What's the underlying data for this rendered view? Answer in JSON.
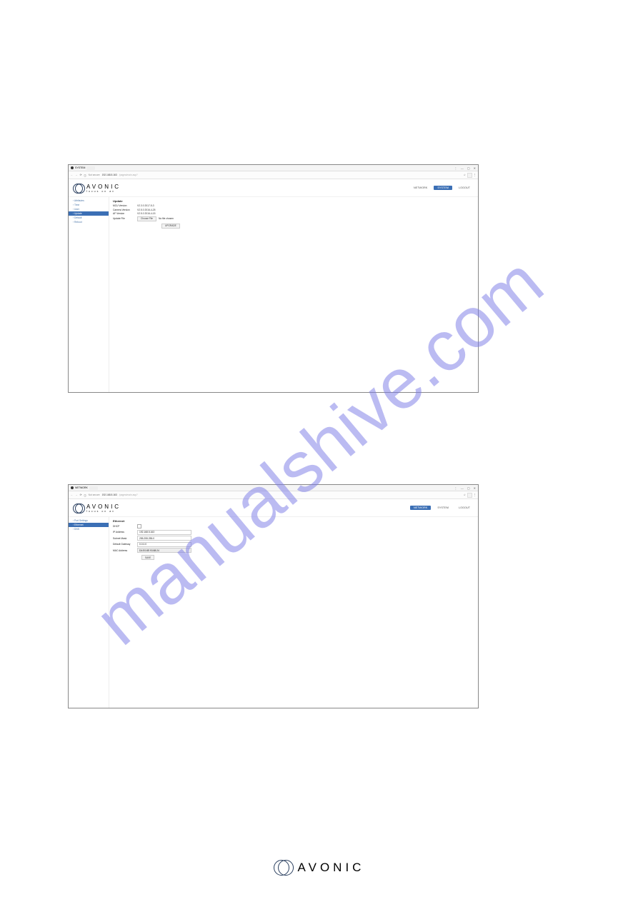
{
  "watermark": "manualshive.com",
  "footer_brand": "AVONIC",
  "screenshot1": {
    "tab_title": "SYSTEM",
    "not_secure": "Not secure",
    "url_host": "192.168.5.163",
    "url_path": "/pages/main.asp?",
    "logo_main": "AVONIC",
    "logo_sub": "focus on av",
    "header_tabs": {
      "network": "NETWORK",
      "system": "SYSTEM",
      "logout": "LOGOUT"
    },
    "sidebar": {
      "items": [
        {
          "label": "Attributes"
        },
        {
          "label": "Time"
        },
        {
          "label": "User"
        },
        {
          "label": "Update"
        },
        {
          "label": "Default"
        },
        {
          "label": "Reboot"
        }
      ]
    },
    "content": {
      "heading": "Update",
      "rows": [
        {
          "lbl": "MCU Version",
          "val": "V2.3.0 2017-5-3"
        },
        {
          "lbl": "Camera Version",
          "val": "V2.5.0 2016-4-25"
        },
        {
          "lbl": "AF Version",
          "val": "V2.5.0 2016-4-15"
        }
      ],
      "update_file_lbl": "Update File",
      "choose_btn": "Choose File",
      "nofile": "No file chosen",
      "upgrade_btn": "UPGRADE"
    }
  },
  "screenshot2": {
    "tab_title": "NETWORK",
    "not_secure": "Not secure",
    "url_host": "192.168.5.163",
    "url_path": "/pages/main.asp?",
    "logo_main": "AVONIC",
    "logo_sub": "focus on av",
    "header_tabs": {
      "network": "NETWORK",
      "system": "SYSTEM",
      "logout": "LOGOUT"
    },
    "sidebar": {
      "items": [
        {
          "label": "Port Settings"
        },
        {
          "label": "Ethernet"
        },
        {
          "label": "DNS"
        }
      ]
    },
    "content": {
      "heading": "Ethernet",
      "dhcp_lbl": "DHCP",
      "rows": [
        {
          "lbl": "IP Address",
          "val": "192.168.5.163"
        },
        {
          "lbl": "Subnet Mask",
          "val": "255.255.255.0"
        },
        {
          "lbl": "Default Gateway",
          "val": "0.0.0.0"
        },
        {
          "lbl": "MAC Address",
          "val": "D4:E0:8E:93:88:24"
        }
      ],
      "save_btn": "SAVE"
    }
  },
  "window_controls": {
    "min": "—",
    "max": "▢",
    "close": "✕",
    "settings": "⋮",
    "star": "☆"
  }
}
